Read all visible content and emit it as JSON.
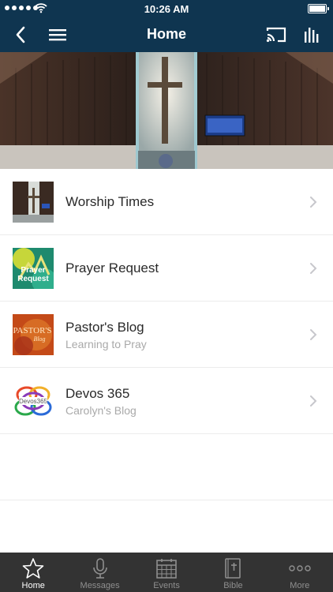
{
  "status_bar": {
    "time": "10:26 AM"
  },
  "header": {
    "title": "Home"
  },
  "colors": {
    "navbar": "#0f3550",
    "tabbar": "#333333",
    "active_tab": "#ffffff",
    "inactive_tab": "#8f8f8f"
  },
  "list": {
    "items": [
      {
        "title": "Worship Times",
        "subtitle": "",
        "icon": "worship-thumbnail"
      },
      {
        "title": "Prayer Request",
        "subtitle": "",
        "icon": "prayer-request-thumbnail"
      },
      {
        "title": "Pastor's Blog",
        "subtitle": "Learning to Pray",
        "icon": "pastors-blog-thumbnail"
      },
      {
        "title": "Devos 365",
        "subtitle": "Carolyn's Blog",
        "icon": "devos365-thumbnail"
      }
    ]
  },
  "tabs": [
    {
      "label": "Home",
      "icon": "star-icon",
      "active": true
    },
    {
      "label": "Messages",
      "icon": "microphone-icon",
      "active": false
    },
    {
      "label": "Events",
      "icon": "calendar-icon",
      "active": false
    },
    {
      "label": "Bible",
      "icon": "bible-icon",
      "active": false
    },
    {
      "label": "More",
      "icon": "more-icon",
      "active": false
    }
  ]
}
